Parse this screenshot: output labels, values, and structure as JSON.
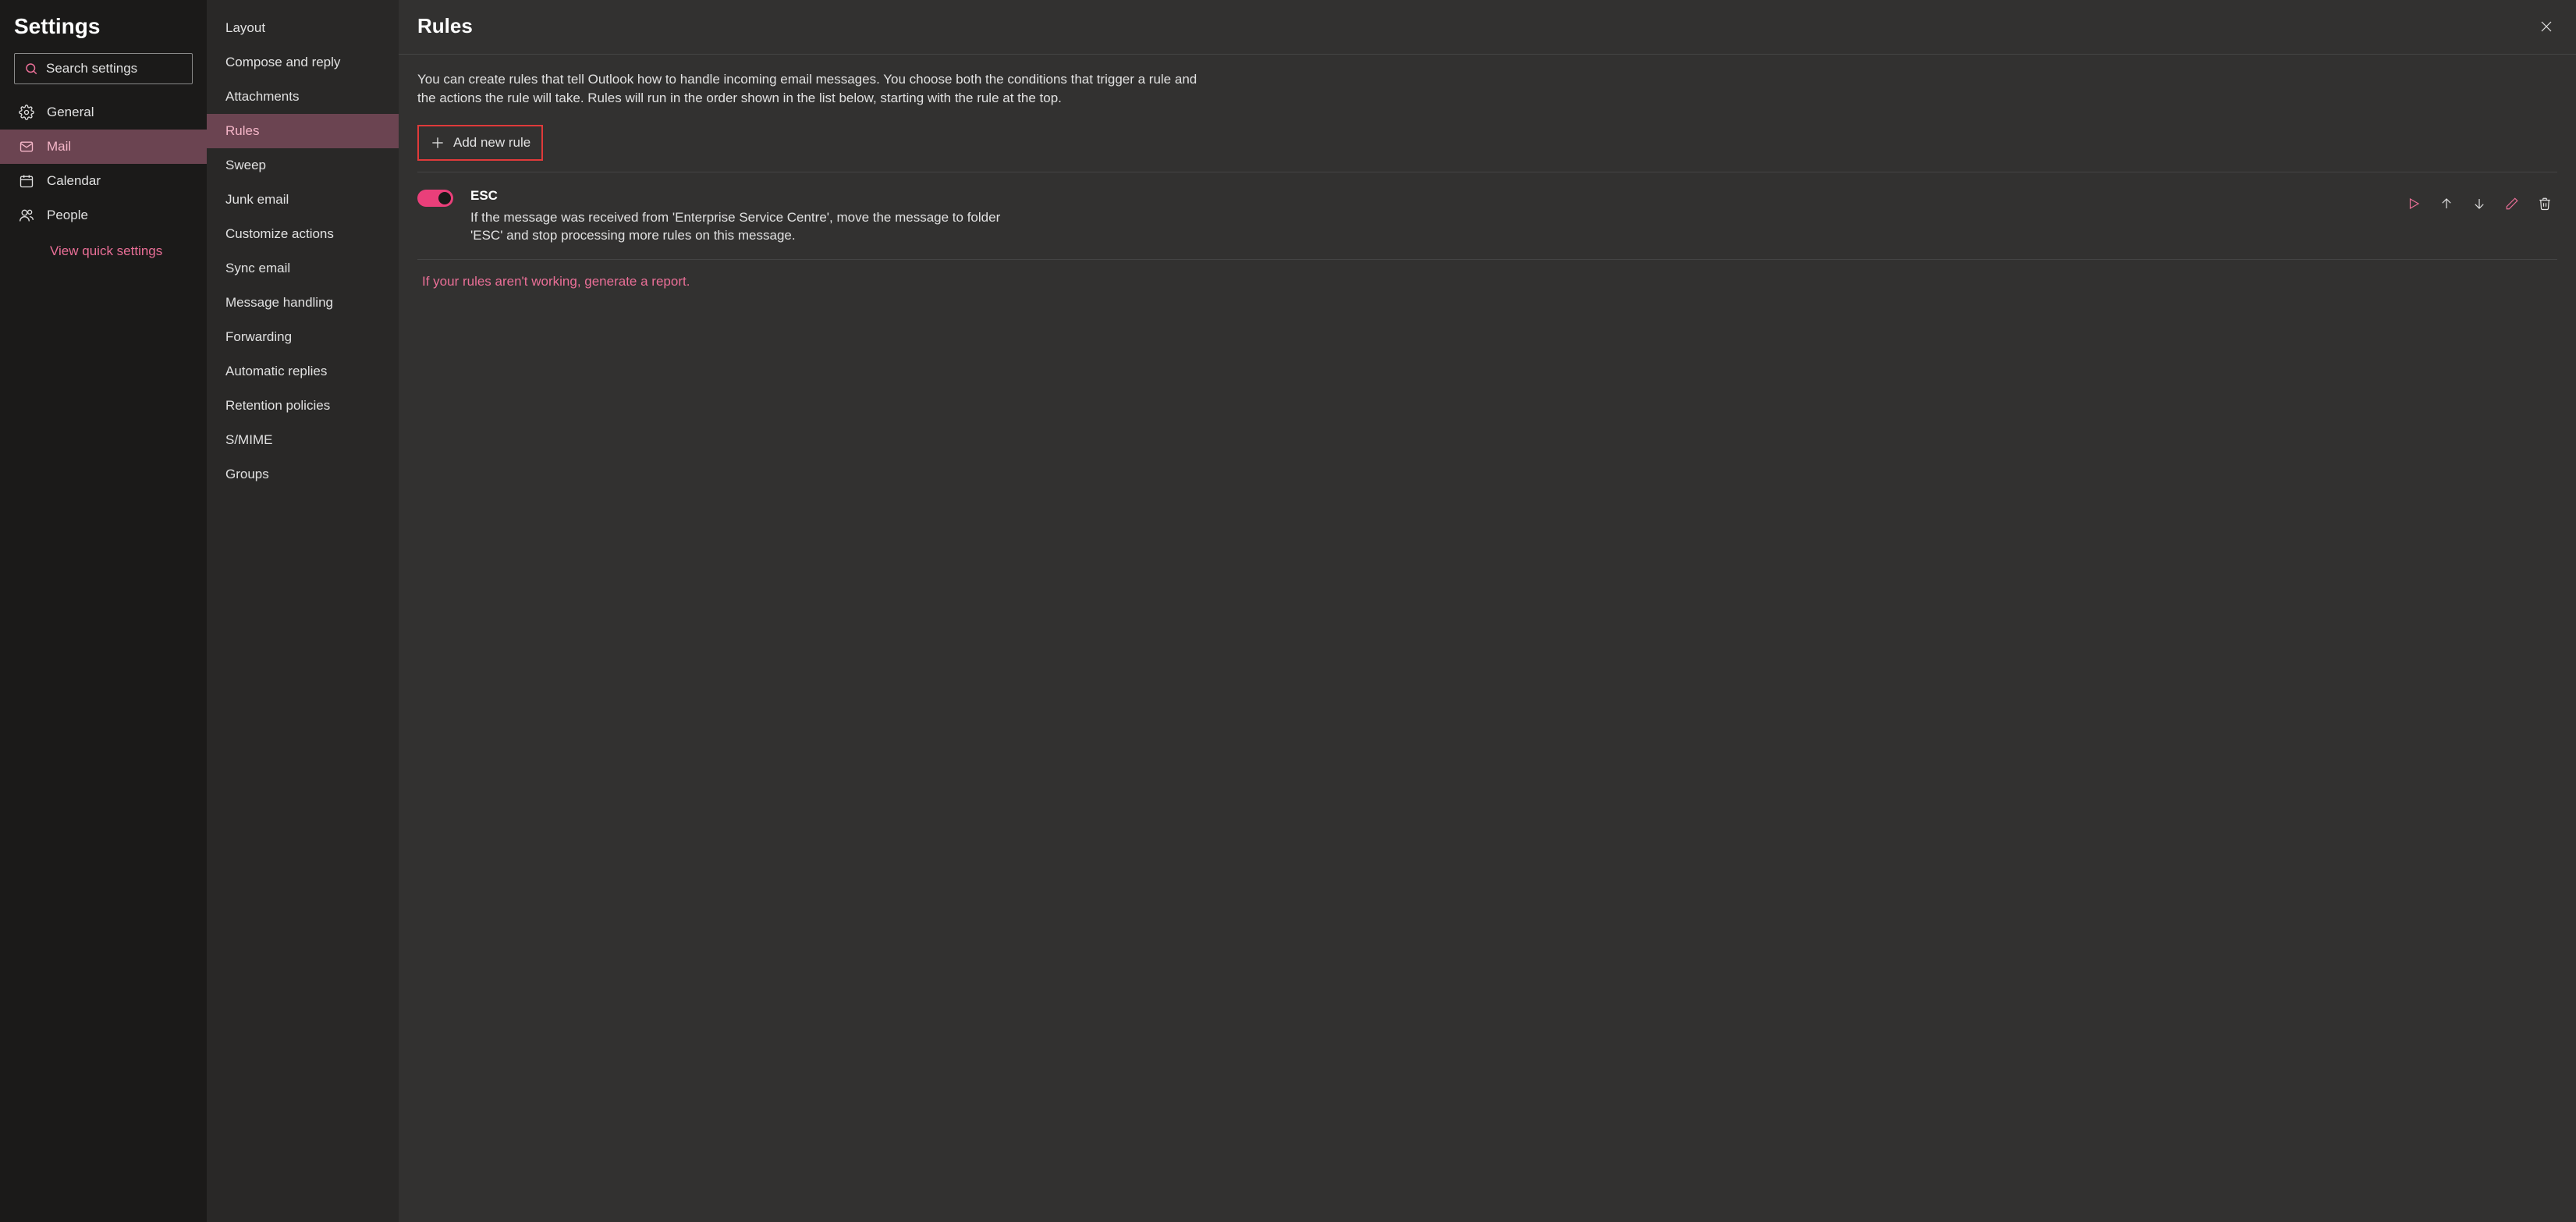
{
  "colors": {
    "accent": "#ea6f97",
    "highlight_box": "#e03a3a",
    "toggle_on": "#ea3f7a"
  },
  "nav": {
    "title": "Settings",
    "search_placeholder": "Search settings",
    "items": [
      {
        "icon": "gear-icon",
        "label": "General"
      },
      {
        "icon": "mail-icon",
        "label": "Mail"
      },
      {
        "icon": "calendar-icon",
        "label": "Calendar"
      },
      {
        "icon": "people-icon",
        "label": "People"
      }
    ],
    "active_index": 1,
    "quick_link": "View quick settings"
  },
  "subnav": {
    "items": [
      "Layout",
      "Compose and reply",
      "Attachments",
      "Rules",
      "Sweep",
      "Junk email",
      "Customize actions",
      "Sync email",
      "Message handling",
      "Forwarding",
      "Automatic replies",
      "Retention policies",
      "S/MIME",
      "Groups"
    ],
    "active_index": 3
  },
  "content": {
    "title": "Rules",
    "intro": "You can create rules that tell Outlook how to handle incoming email messages. You choose both the conditions that trigger a rule and the actions the rule will take. Rules will run in the order shown in the list below, starting with the rule at the top.",
    "add_button": "Add new rule",
    "rules": [
      {
        "enabled": true,
        "name": "ESC",
        "description": "If the message was received from 'Enterprise Service Centre', move the message to folder 'ESC' and stop processing more rules on this message."
      }
    ],
    "report_link": "If your rules aren't working, generate a report."
  }
}
